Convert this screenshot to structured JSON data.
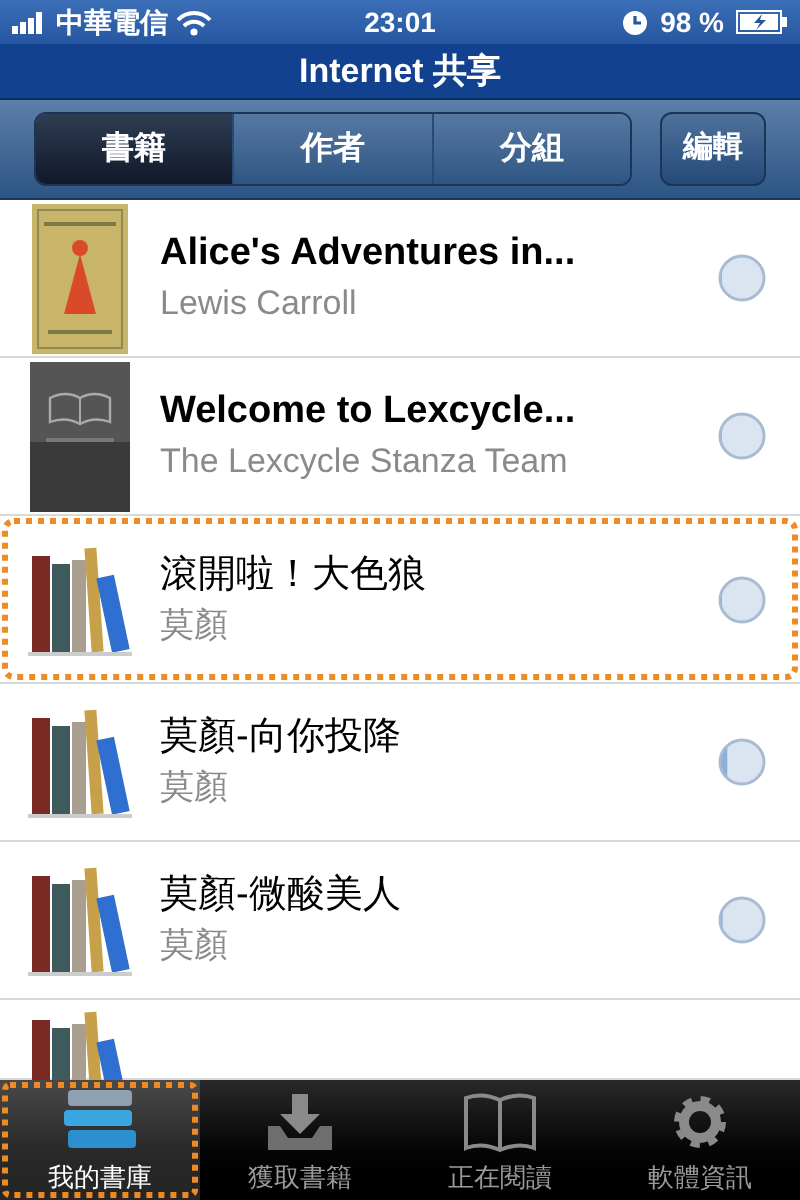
{
  "status_bar": {
    "carrier": "中華電信",
    "time": "23:01",
    "battery": "98 %"
  },
  "nav_bar": {
    "title": "Internet 共享"
  },
  "segments": [
    {
      "label": "書籍",
      "selected": true
    },
    {
      "label": "作者",
      "selected": false
    },
    {
      "label": "分組",
      "selected": false
    }
  ],
  "edit_button": "編輯",
  "books": [
    {
      "kind": "illustrated",
      "title": "Alice's Adventures in...",
      "author": "Lewis Carroll",
      "level": 0,
      "highlighted": false
    },
    {
      "kind": "stanza",
      "title": "Welcome to Lexcycle...",
      "author": "The Lexcycle Stanza Team",
      "level": 0,
      "highlighted": false
    },
    {
      "kind": "calibre",
      "title": "滾開啦！大色狼",
      "author": "莫顏",
      "level": 0,
      "highlighted": true
    },
    {
      "kind": "calibre",
      "title": "莫顏-向你投降",
      "author": "莫顏",
      "level": 0.15,
      "highlighted": false
    },
    {
      "kind": "calibre",
      "title": "莫顏-微酸美人",
      "author": "莫顏",
      "level": 0.04,
      "highlighted": false
    },
    {
      "kind": "calibre_partial"
    }
  ],
  "tab_bar": [
    {
      "label": "我的書庫",
      "selected": true
    },
    {
      "label": "獲取書籍",
      "selected": false
    },
    {
      "label": "正在閱讀",
      "selected": false
    },
    {
      "label": "軟體資訊",
      "selected": false
    }
  ]
}
